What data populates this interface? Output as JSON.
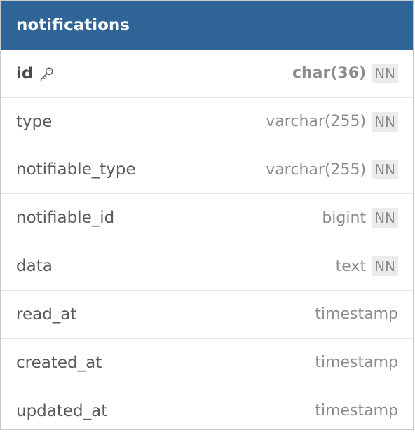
{
  "table": {
    "title": "notifications",
    "columns": [
      {
        "name": "id",
        "type": "char(36)",
        "constraint": "NN",
        "primary_key": true,
        "icon": "key-icon"
      },
      {
        "name": "type",
        "type": "varchar(255)",
        "constraint": "NN"
      },
      {
        "name": "notifiable_type",
        "type": "varchar(255)",
        "constraint": "NN"
      },
      {
        "name": "notifiable_id",
        "type": "bigint",
        "constraint": "NN"
      },
      {
        "name": "data",
        "type": "text",
        "constraint": "NN"
      },
      {
        "name": "read_at",
        "type": "timestamp",
        "constraint": ""
      },
      {
        "name": "created_at",
        "type": "timestamp",
        "constraint": ""
      },
      {
        "name": "updated_at",
        "type": "timestamp",
        "constraint": ""
      }
    ]
  },
  "colors": {
    "header_bg": "#2f6596",
    "header_text": "#ffffff",
    "name_text": "#5a5a5a",
    "type_text": "#8c8c8c",
    "badge_bg": "#ebebeb"
  }
}
